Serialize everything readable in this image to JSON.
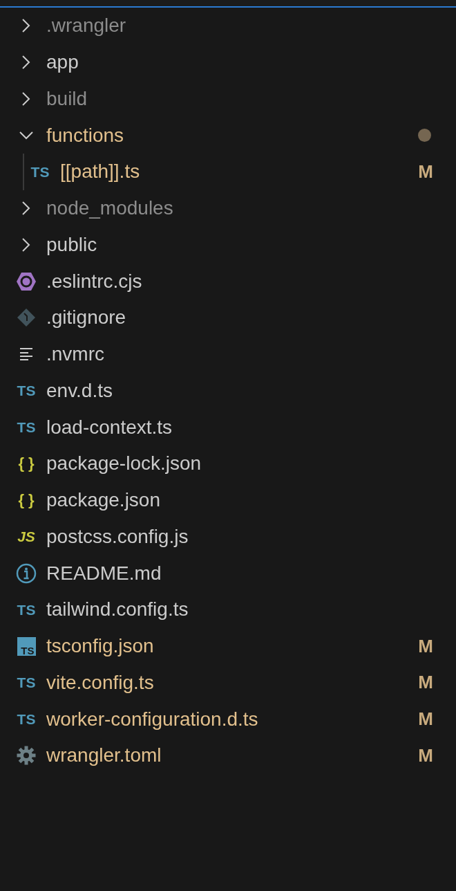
{
  "tree": [
    {
      "kind": "folder",
      "name": ".wrangler",
      "expanded": false,
      "ignored": true,
      "modified": false
    },
    {
      "kind": "folder",
      "name": "app",
      "expanded": false,
      "ignored": false,
      "modified": false
    },
    {
      "kind": "folder",
      "name": "build",
      "expanded": false,
      "ignored": true,
      "modified": false
    },
    {
      "kind": "folder",
      "name": "functions",
      "expanded": true,
      "ignored": false,
      "modified": true,
      "children": [
        {
          "kind": "ts",
          "icon_label": "TS",
          "name": "[[path]].ts",
          "ignored": false,
          "modified": true,
          "badge": "M"
        }
      ]
    },
    {
      "kind": "folder",
      "name": "node_modules",
      "expanded": false,
      "ignored": true,
      "modified": false
    },
    {
      "kind": "folder",
      "name": "public",
      "expanded": false,
      "ignored": false,
      "modified": false
    },
    {
      "kind": "eslint",
      "name": ".eslintrc.cjs",
      "ignored": false,
      "modified": false
    },
    {
      "kind": "git",
      "name": ".gitignore",
      "ignored": false,
      "modified": false
    },
    {
      "kind": "text",
      "name": ".nvmrc",
      "ignored": false,
      "modified": false
    },
    {
      "kind": "ts",
      "icon_label": "TS",
      "name": "env.d.ts",
      "ignored": false,
      "modified": false
    },
    {
      "kind": "ts",
      "icon_label": "TS",
      "name": "load-context.ts",
      "ignored": false,
      "modified": false
    },
    {
      "kind": "json",
      "icon_label": "{ }",
      "name": "package-lock.json",
      "ignored": false,
      "modified": false
    },
    {
      "kind": "json",
      "icon_label": "{ }",
      "name": "package.json",
      "ignored": false,
      "modified": false
    },
    {
      "kind": "js",
      "icon_label": "JS",
      "name": "postcss.config.js",
      "ignored": false,
      "modified": false
    },
    {
      "kind": "info",
      "name": "README.md",
      "ignored": false,
      "modified": false
    },
    {
      "kind": "ts",
      "icon_label": "TS",
      "name": "tailwind.config.ts",
      "ignored": false,
      "modified": false
    },
    {
      "kind": "tsconfig",
      "icon_label": "TS",
      "name": "tsconfig.json",
      "ignored": false,
      "modified": true,
      "badge": "M"
    },
    {
      "kind": "ts",
      "icon_label": "TS",
      "name": "vite.config.ts",
      "ignored": false,
      "modified": true,
      "badge": "M"
    },
    {
      "kind": "ts",
      "icon_label": "TS",
      "name": "worker-configuration.d.ts",
      "ignored": false,
      "modified": true,
      "badge": "M"
    },
    {
      "kind": "gear",
      "name": "wrangler.toml",
      "ignored": false,
      "modified": true,
      "badge": "M"
    }
  ]
}
